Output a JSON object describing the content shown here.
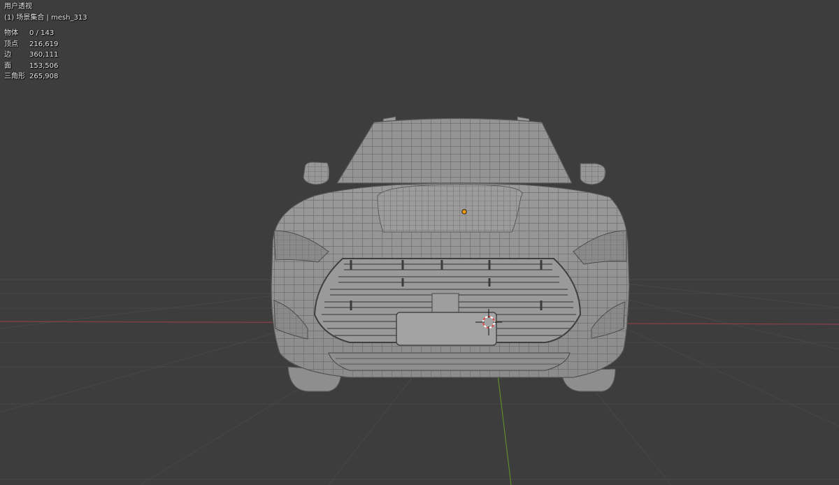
{
  "viewport": {
    "view_name": "用户透视",
    "collection_line": "(1) 场景集合 | mesh_313",
    "background_color": "#3d3d3d",
    "grid_color": "#474747",
    "x_axis_color": "#a3404f",
    "y_axis_color": "#6f9b2f",
    "origin_color": "#f39c12"
  },
  "stats": [
    {
      "label": "物体",
      "value": "0 / 143"
    },
    {
      "label": "顶点",
      "value": "216,619"
    },
    {
      "label": "边",
      "value": "360,111"
    },
    {
      "label": "面",
      "value": "153,506"
    },
    {
      "label": "三角形",
      "value": "265,908"
    }
  ],
  "icons": {
    "cursor": "3d-cursor-icon",
    "origin": "object-origin-icon"
  }
}
